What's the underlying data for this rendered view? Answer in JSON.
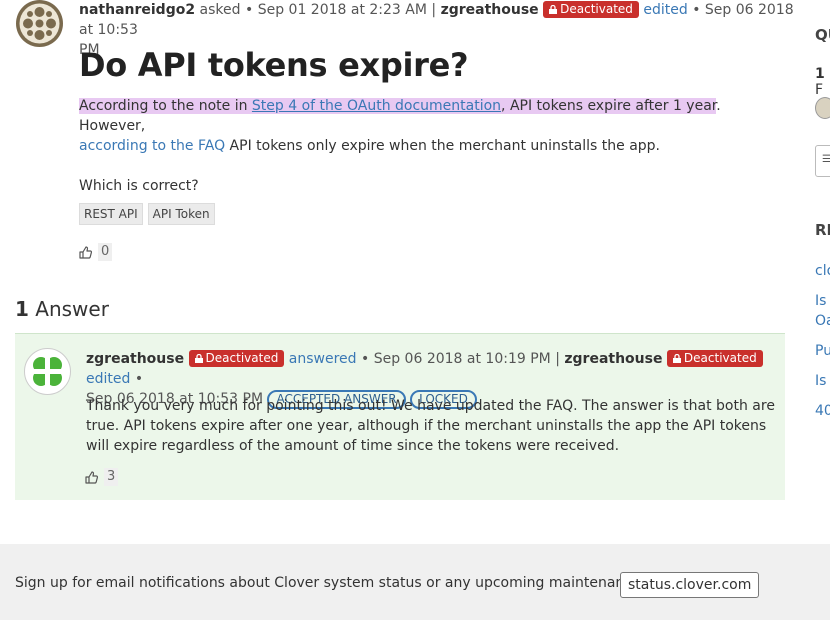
{
  "question": {
    "author": "nathanreidgo2",
    "asked_label": "asked",
    "asked_date": "Sep 01 2018 at 2:23 AM",
    "editor": "zgreathouse",
    "editor_badge": "Deactivated",
    "edited_label": "edited",
    "edited_date_part1": "Sep 06 2018 at 10:53",
    "edited_date_part2": "PM",
    "title": "Do API tokens expire?",
    "body": {
      "p1_seg1": "According to the note in ",
      "p1_link1": "Step 4 of the OAuth documentation",
      "p1_seg2": ", API tokens expire after 1 year",
      "p1_seg3": ". However,",
      "p1_link2": "according to the FAQ",
      "p1_seg4": " API tokens only expire when the merchant uninstalls the app.",
      "p2": "Which is correct?"
    },
    "tags": [
      "REST API",
      "API Token"
    ],
    "votes": "0"
  },
  "answers": {
    "count": "1",
    "label": "Answer",
    "items": [
      {
        "author": "zgreathouse",
        "author_badge": "Deactivated",
        "answered_label": "answered",
        "answered_date": "Sep 06 2018 at 10:19 PM",
        "editor": "zgreathouse",
        "editor_badge": "Deactivated",
        "edited_label": "edited",
        "edited_date": "Sep 06 2018 at 10:53 PM",
        "pills": [
          "ACCEPTED ANSWER",
          "LOCKED"
        ],
        "body": "Thank you very much for pointing this out! We have updated the FAQ. The answer is that both are true. API tokens expire after one year, although if the merchant uninstalls the app the API tokens will expire regardless of the amount of time since the tokens were received.",
        "votes": "3"
      }
    ]
  },
  "sidebar": {
    "heading1": "QU",
    "stat": "1",
    "stat_rest": "F",
    "heading2": "RE",
    "links": [
      "clo",
      "Is",
      "Oa",
      "Pu",
      "Is",
      "40"
    ]
  },
  "footer": {
    "text": "Sign up for email notifications about Clover system status or any upcoming maintenance:",
    "button": "status.clover.com"
  }
}
